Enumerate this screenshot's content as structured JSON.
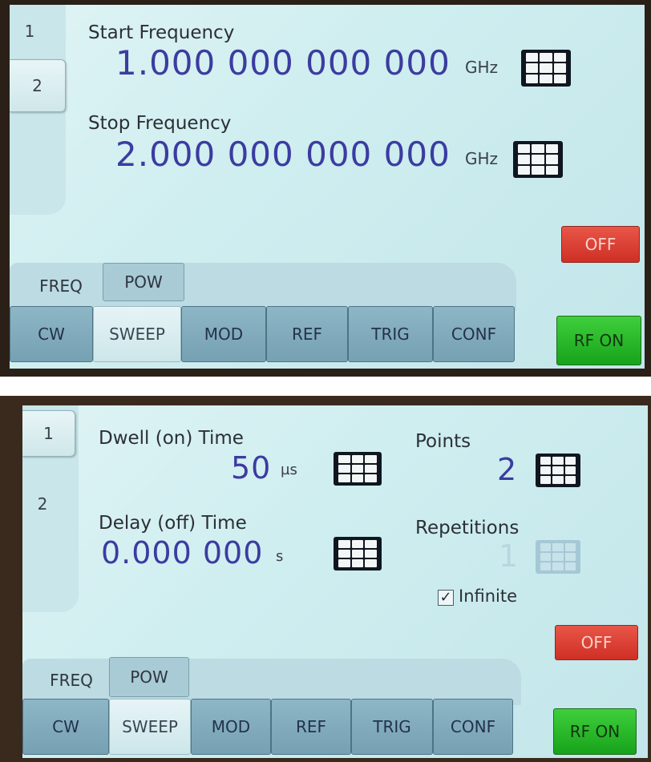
{
  "screen1": {
    "channels": [
      "1",
      "2"
    ],
    "start": {
      "label": "Start Frequency",
      "value": "1.000 000 000 000",
      "unit": "GHz",
      "keypad_icon": "keypad-icon"
    },
    "stop": {
      "label": "Stop Frequency",
      "value": "2.000 000 000 000",
      "unit": "GHz",
      "keypad_icon": "keypad-icon"
    },
    "off_label": "OFF",
    "rf_on_label": "RF ON",
    "subtabs": [
      "FREQ",
      "POW"
    ],
    "tabs": [
      "CW",
      "SWEEP",
      "MOD",
      "REF",
      "TRIG",
      "CONF"
    ],
    "active_tab": "SWEEP"
  },
  "screen2": {
    "channels": [
      "1",
      "2"
    ],
    "dwell": {
      "label": "Dwell (on) Time",
      "value": "50",
      "unit": "µs"
    },
    "delay": {
      "label": "Delay (off) Time",
      "value": "0.000 000",
      "unit": "s"
    },
    "points": {
      "label": "Points",
      "value": "2"
    },
    "repetitions": {
      "label": "Repetitions",
      "value": "1"
    },
    "infinite": {
      "label": "Infinite",
      "checked": true,
      "check_glyph": "✓"
    },
    "off_label": "OFF",
    "rf_on_label": "RF ON",
    "subtabs": [
      "FREQ",
      "POW"
    ],
    "tabs": [
      "CW",
      "SWEEP",
      "MOD",
      "REF",
      "TRIG",
      "CONF"
    ],
    "active_tab": "SWEEP"
  },
  "colors": {
    "value_text": "#3b3ca0",
    "off_button": "#d9382c",
    "rf_on_button": "#27b827",
    "tab_bg": "#84adbf"
  }
}
